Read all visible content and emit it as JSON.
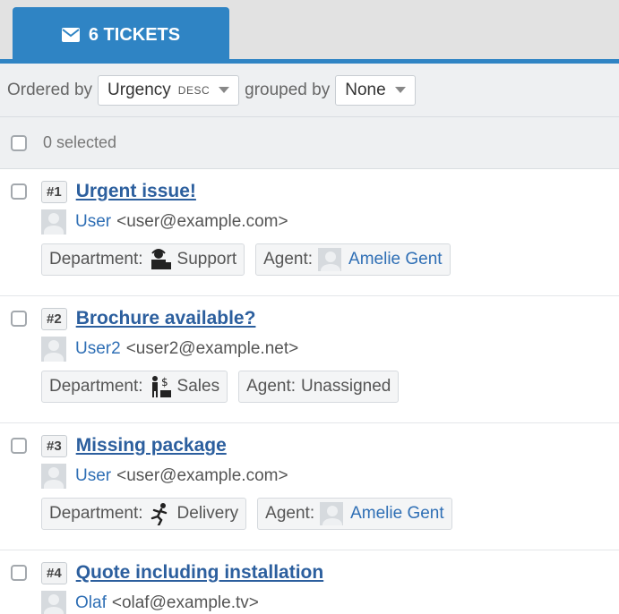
{
  "tab": {
    "label": "6 TICKETS"
  },
  "toolbar": {
    "ordered_by_label": "Ordered by",
    "order_value": "Urgency",
    "order_direction": "DESC",
    "grouped_by_label": "grouped by",
    "group_value": "None"
  },
  "selection": {
    "text": "0 selected"
  },
  "tickets": [
    {
      "number": "#1",
      "subject": "Urgent issue!",
      "user_name": "User",
      "user_email": "<user@example.com>",
      "department_label": "Department:",
      "department": "Support",
      "department_icon": "support-agent-icon",
      "agent_label": "Agent:",
      "agent": "Amelie Gent"
    },
    {
      "number": "#2",
      "subject": "Brochure available?",
      "user_name": "User2",
      "user_email": "<user2@example.net>",
      "department_label": "Department:",
      "department": "Sales",
      "department_icon": "sales-person-icon",
      "agent_label": "Agent:",
      "agent": "Unassigned"
    },
    {
      "number": "#3",
      "subject": "Missing package",
      "user_name": "User",
      "user_email": "<user@example.com>",
      "department_label": "Department:",
      "department": "Delivery",
      "department_icon": "running-courier-icon",
      "agent_label": "Agent:",
      "agent": "Amelie Gent"
    },
    {
      "number": "#4",
      "subject": "Quote including installation",
      "user_name": "Olaf",
      "user_email": "<olaf@example.tv>"
    }
  ],
  "colors": {
    "accent": "#2f84c4",
    "link": "#2c5f9e"
  }
}
